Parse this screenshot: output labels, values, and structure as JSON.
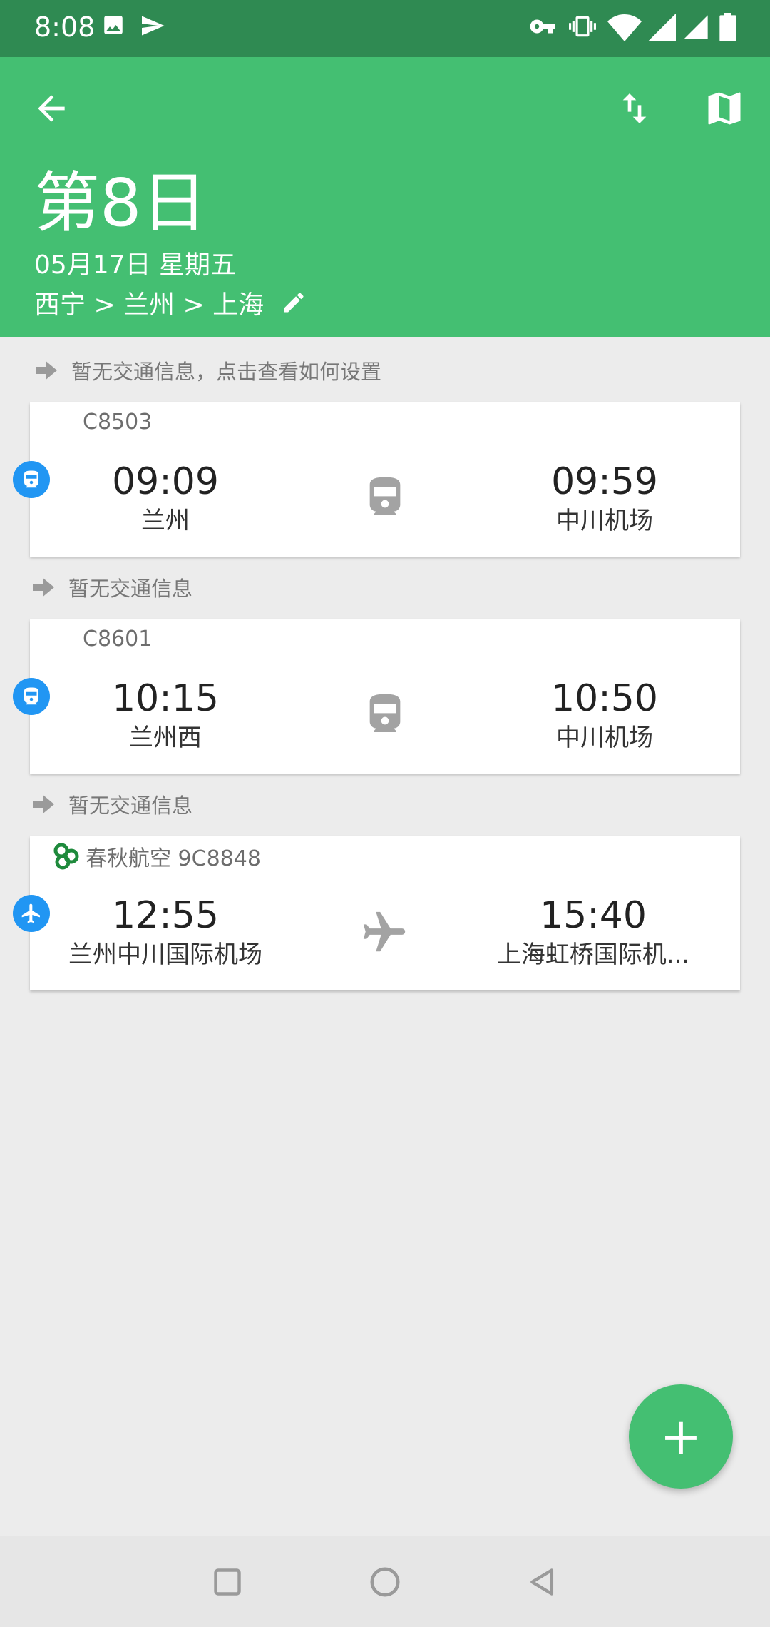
{
  "status_bar": {
    "time": "8:08"
  },
  "header": {
    "day_title": "第8日",
    "date": "05月17日 星期五",
    "route": "西宁 > 兰州 > 上海"
  },
  "hints": [
    "暂无交通信息，点击查看如何设置",
    "暂无交通信息",
    "暂无交通信息"
  ],
  "segments": [
    {
      "type": "train",
      "code": "C8503",
      "dep_time": "09:09",
      "dep_station": "兰州",
      "arr_time": "09:59",
      "arr_station": "中川机场"
    },
    {
      "type": "train",
      "code": "C8601",
      "dep_time": "10:15",
      "dep_station": "兰州西",
      "arr_time": "10:50",
      "arr_station": "中川机场"
    },
    {
      "type": "flight",
      "code": "春秋航空 9C8848",
      "dep_time": "12:55",
      "dep_station": "兰州中川国际机场",
      "arr_time": "15:40",
      "arr_station": "上海虹桥国际机..."
    }
  ],
  "fab": {
    "icon": "plus-icon",
    "label": "+"
  },
  "colors": {
    "header": "#44bf72",
    "status_bar": "#2f8a52",
    "badge": "#2196f3",
    "airline_logo": "#1e8a3c"
  }
}
